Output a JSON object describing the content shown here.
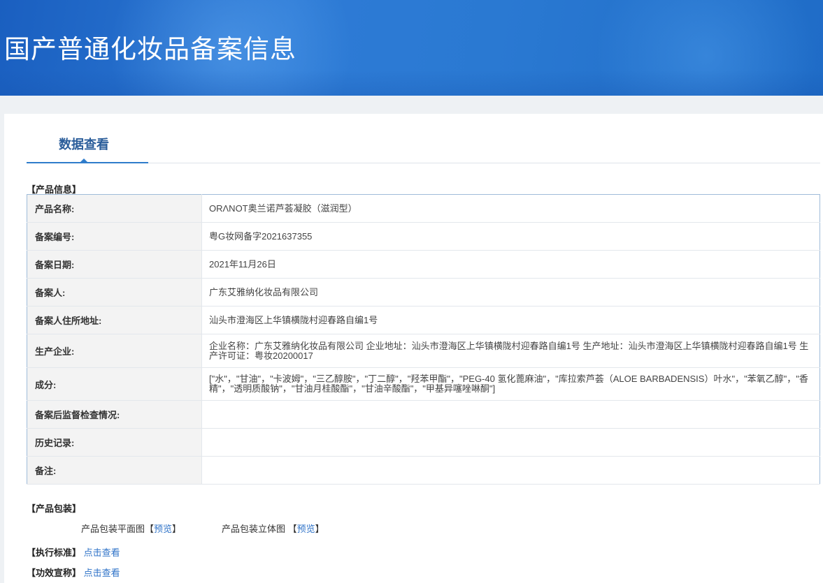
{
  "header": {
    "title": "国产普通化妆品备案信息"
  },
  "tabs": [
    {
      "label": "数据查看",
      "active": true
    }
  ],
  "product_info": {
    "section_label": "【产品信息】",
    "rows": [
      {
        "key": "产品名称:",
        "value": "ORΛNOT奥兰诺芦荟凝胶（滋润型）"
      },
      {
        "key": "备案编号:",
        "value": "粤G妆网备字2021637355"
      },
      {
        "key": "备案日期:",
        "value": "2021年11月26日"
      },
      {
        "key": "备案人:",
        "value": "广东艾雅纳化妆品有限公司"
      },
      {
        "key": "备案人住所地址:",
        "value": "汕头市澄海区上华镇横陇村迎春路自编1号"
      },
      {
        "key": "生产企业:",
        "value": "企业名称：广东艾雅纳化妆品有限公司 企业地址：汕头市澄海区上华镇横陇村迎春路自编1号 生产地址：汕头市澄海区上华镇横陇村迎春路自编1号 生产许可证：粤妆20200017"
      },
      {
        "key": "成分:",
        "value": "[\"水\"，\"甘油\"，\"卡波姆\"，\"三乙醇胺\"，\"丁二醇\"，\"羟苯甲酯\"，\"PEG-40 氢化蓖麻油\"，\"库拉索芦荟（ALOE BARBADENSIS）叶水\"，\"苯氧乙醇\"，\"香精\"，\"透明质酸钠\"，\"甘油月桂酸酯\"，\"甘油辛酸酯\"，\"甲基异噻唑啉酮\"]"
      },
      {
        "key": "备案后监督检查情况:",
        "value": ""
      },
      {
        "key": "历史记录:",
        "value": ""
      },
      {
        "key": "备注:",
        "value": ""
      }
    ]
  },
  "packaging": {
    "section_label": "【产品包装】",
    "flat_label": "产品包装平面图",
    "flat_link": "预览",
    "solid_label": "产品包装立体图",
    "solid_link": "预览",
    "bracket_open": "【",
    "bracket_close": "】"
  },
  "standard": {
    "label": "【执行标准】",
    "link": "点击查看"
  },
  "efficacy": {
    "label": "【功效宣称】",
    "link": "点击查看"
  }
}
